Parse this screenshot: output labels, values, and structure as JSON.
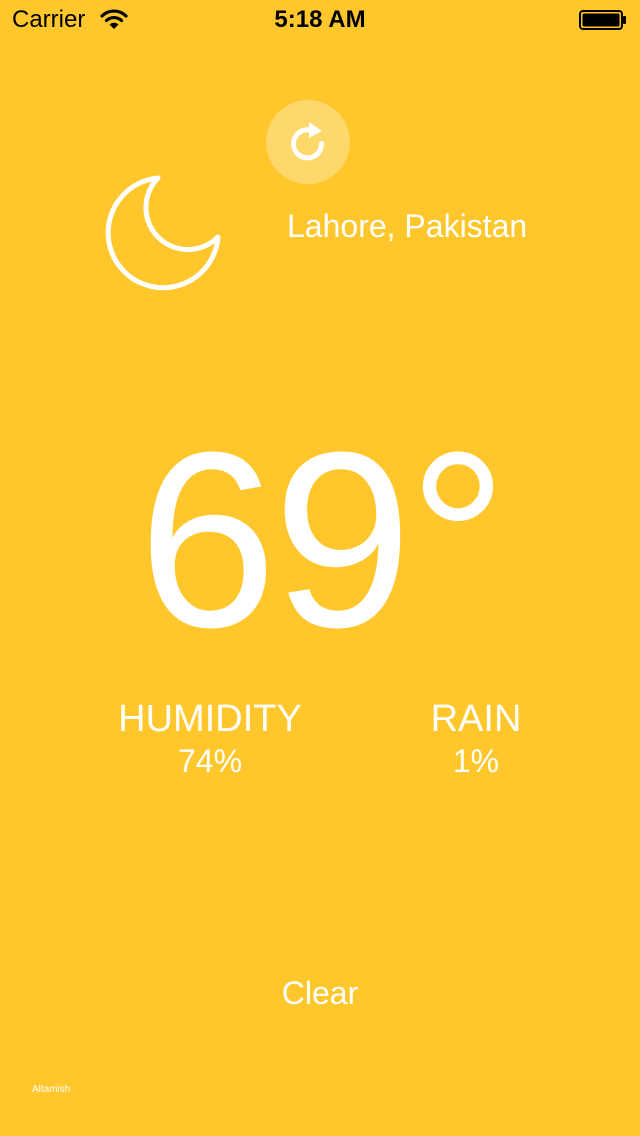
{
  "status_bar": {
    "carrier": "Carrier",
    "time": "5:18 AM",
    "wifi_icon": "wifi-icon",
    "battery_icon": "battery-icon"
  },
  "refresh": {
    "icon": "refresh-icon"
  },
  "weather": {
    "condition_icon": "moon-icon",
    "location": "Lahore, Pakistan",
    "temperature": "69°",
    "humidity_label": "HUMIDITY",
    "humidity_value": "74%",
    "rain_label": "RAIN",
    "rain_value": "1%",
    "summary": "Clear"
  },
  "credit": "Altamish",
  "colors": {
    "background": "#FFC72C",
    "text": "#FFFFFF",
    "status_text": "#000000"
  }
}
